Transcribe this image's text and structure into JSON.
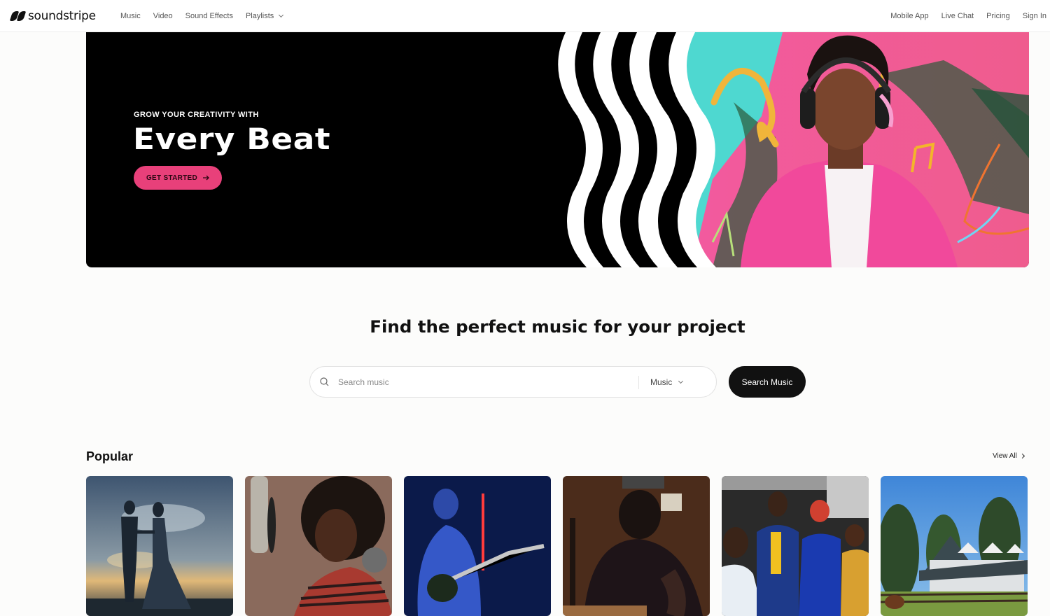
{
  "header": {
    "logo_text": "soundstripe",
    "nav_left": [
      {
        "label": "Music"
      },
      {
        "label": "Video"
      },
      {
        "label": "Sound Effects"
      },
      {
        "label": "Playlists",
        "has_dropdown": true
      }
    ],
    "nav_right": [
      {
        "label": "Mobile App"
      },
      {
        "label": "Live Chat"
      },
      {
        "label": "Pricing"
      },
      {
        "label": "Sign In"
      }
    ]
  },
  "hero": {
    "eyebrow": "GROW YOUR CREATIVITY WITH",
    "title": "Every Beat",
    "cta_label": "GET STARTED",
    "cta_icon": "arrow-right-icon",
    "accent_color": "#e8407a",
    "image_description": "Man with headphones in pink shirt beside black and white wavy stripes"
  },
  "search": {
    "title": "Find the perfect music for your project",
    "placeholder": "Search music",
    "value": "",
    "type_selected": "Music",
    "button_label": "Search Music",
    "icon": "search-icon"
  },
  "popular": {
    "title": "Popular",
    "view_all_label": "View All",
    "cards": [
      {
        "image_description": "Wedding couple silhouette at sunset"
      },
      {
        "image_description": "Woman singing into studio microphone"
      },
      {
        "image_description": "Guitarist under blue light with red neon"
      },
      {
        "image_description": "Man with headphones in wood-paneled room"
      },
      {
        "image_description": "Colleagues laughing in office"
      },
      {
        "image_description": "Farmhouse with horse and trees"
      }
    ]
  }
}
